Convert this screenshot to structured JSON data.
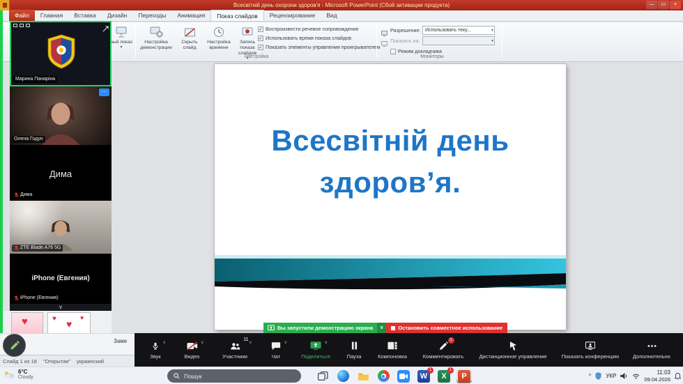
{
  "colors": {
    "titlebar_red": "#b3261a",
    "file_tab_red": "#c23b2a",
    "slide_title_blue": "#1e76c8",
    "share_green": "#2aae4f",
    "stop_red": "#e03131",
    "active_speaker_green": "#23d35f",
    "zoom_blue": "#2d8cff",
    "share_border_green": "#18d04b"
  },
  "titlebar": {
    "title": "Всесвітній день охорони здоров'я - Microsoft PowerPoint (Сбой активации продукта)",
    "minimize": "—",
    "maximize": "▭",
    "close": "×"
  },
  "ribbon": {
    "tabs": [
      {
        "label": "Файл"
      },
      {
        "label": "Главная"
      },
      {
        "label": "Вставка"
      },
      {
        "label": "Дизайн"
      },
      {
        "label": "Переходы"
      },
      {
        "label": "Анимация"
      },
      {
        "label": "Показ слайдов"
      },
      {
        "label": "Рецензирование"
      },
      {
        "label": "Вид"
      }
    ],
    "active_tab": "Показ слайдов",
    "custom_show_label": "ный показ",
    "buttons": [
      {
        "label": "Настройка демонстрации"
      },
      {
        "label": "Скрыть слайд"
      },
      {
        "label": "Настройка времени"
      },
      {
        "label": "Запись показа слайдов"
      }
    ],
    "checkboxes": [
      {
        "label": "Воспроизвести речевое сопровождение",
        "checked": true
      },
      {
        "label": "Использовать время показа слайдов",
        "checked": true
      },
      {
        "label": "Показать элементы управления проигрывателем",
        "checked": true
      }
    ],
    "group_setup": "Настройка",
    "monitors": {
      "resolution_label": "Разрешение:",
      "resolution_value": "Использовать теку...",
      "show_on_label": "Показать на:",
      "presenter_checkbox": "Режим докладчика",
      "group_label": "Мониторы"
    },
    "glyphs": {
      "dropdown": "▾",
      "check": "✓"
    }
  },
  "slide": {
    "title_line1": "Всесвітній день",
    "title_line2": "здоров’я."
  },
  "zoom_panel": {
    "participants": [
      {
        "name": "Марина Панаріна",
        "tile": "emblem",
        "muted": false,
        "active_speaker": true
      },
      {
        "name": "Олена Годун",
        "tile": "video",
        "muted": false,
        "menu": "⋯"
      },
      {
        "name": "Дима",
        "tile": "name",
        "muted": true
      },
      {
        "name": "ZTE Blade A76 5G",
        "tile": "video",
        "muted": true
      },
      {
        "name": "iPhone (Евгения)",
        "tile": "name",
        "muted": true
      }
    ],
    "collapse_chevron": "∨"
  },
  "share_banner": {
    "message": "Вы запустили демонстрацию экрана",
    "collapse": "∨",
    "stop_label": "Остановить совместное использование"
  },
  "zoom_toolbar": {
    "chevron": "∨",
    "buttons": [
      {
        "label": "Звук",
        "icon": "microphone-icon",
        "chevron": true
      },
      {
        "label": "Видео",
        "icon": "camera-off-icon",
        "chevron": true
      },
      {
        "label": "Участники",
        "icon": "participants-icon",
        "chevron": true,
        "badge": "11"
      },
      {
        "label": "Чат",
        "icon": "chat-icon",
        "chevron": true
      },
      {
        "label": "Поделиться",
        "icon": "share-screen-icon",
        "chevron": true
      },
      {
        "label": "Пауза",
        "icon": "pause-icon"
      },
      {
        "label": "Компоновка",
        "icon": "layout-icon"
      },
      {
        "label": "Комментировать",
        "icon": "annotate-icon",
        "badge": "1"
      },
      {
        "label": "Дистанционное управление",
        "icon": "remote-control-icon"
      },
      {
        "label": "Показать конференцию",
        "icon": "show-meeting-icon"
      },
      {
        "label": "Дополнительно",
        "icon": "more-icon"
      }
    ]
  },
  "ppt_status": {
    "slide_counter": "Слайд 1 из 18",
    "theme_name": "\"Открытая\"",
    "language": "украинский",
    "notes_fragment": "Заме"
  },
  "decor": {
    "heart": "♥"
  },
  "taskbar": {
    "weather": {
      "temp": "6°C",
      "condition": "Cloudy"
    },
    "search_placeholder": "Пошук",
    "app_icons": [
      {
        "name": "task-view"
      },
      {
        "name": "edge"
      },
      {
        "name": "file-explorer"
      },
      {
        "name": "chrome"
      },
      {
        "name": "zoom"
      },
      {
        "name": "word",
        "letter": "W",
        "badge": "1"
      },
      {
        "name": "excel",
        "letter": "X",
        "badge": "1"
      },
      {
        "name": "powerpoint",
        "letter": "P",
        "active": true
      }
    ],
    "tray": {
      "expand": "^",
      "language": "УКР",
      "time": "11:03",
      "date": "09.04.2026",
      "icons": [
        "shield-icon",
        "volume-icon",
        "network-icon",
        "notifications-icon"
      ]
    }
  }
}
